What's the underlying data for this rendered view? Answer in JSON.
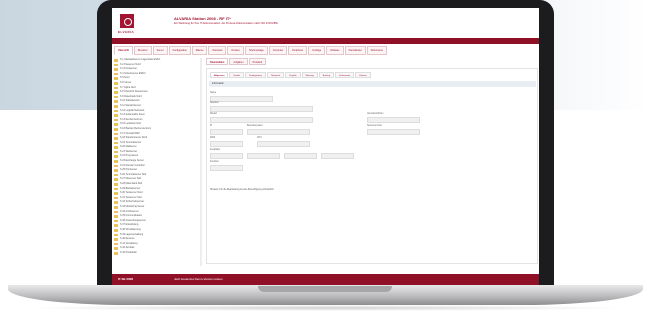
{
  "header": {
    "logo_text": "ELVARIA",
    "title": "ALVARIA Station 2008 - RF IT*",
    "subtitle": "Ein Werkzeug für Ihre IT-Dokumentation, die Prozess-Dokumentation nach ISO 27001/BSI"
  },
  "main_tabs": [
    "Übersicht",
    "Benutzer",
    "Server",
    "Konfiguration",
    "Räume",
    "Netzwerk",
    "Drucker",
    "Telefonanlage",
    "Computer",
    "Peripherie",
    "Verträge",
    "Software",
    "Dienstleister",
    "Dokumente"
  ],
  "tree_items": [
    "S 1 Standardserver Lagerstelle ESKO",
    "S 2 Fileserver Nord",
    "S 3 Firmaserver",
    "S 4 Schutzserver ESKO",
    "S 5 Nord",
    "S 6 Server",
    "S 7 Alpha Netz",
    "S 8 Übersicht Ressourcen",
    "S 9 Datenbank Nord",
    "S 10 Stabsbereich",
    "S 11 Standortserver",
    "S 12 Logistik Netzwerk",
    "S 13 Außenstelle Sued",
    "S 14 Rechenzentrum",
    "S 15 Leitstelle Nord",
    "S 16 Backup Rechenzentrum",
    "S 17 Firewall DMZ",
    "S 18 Standortserver Nord",
    "S 19 Terminalserver",
    "S 20 Mailserver",
    "S 21 Webserver",
    "S 22 Proxyserver",
    "S 23 Exchange Server",
    "S 24 Domain Controller",
    "S 25 Printserver",
    "S 26 Terminalserver Süd",
    "S 27 Fileserver Süd",
    "S 28 Datenbank Süd",
    "S 29 Backupserver",
    "S 30 Testserver Nord",
    "S 31 Testserver Süd",
    "S 32 Sicherheitsserver",
    "S 33 Monitoring Server",
    "S 34 Archivserver",
    "S 35 Kommunikation",
    "S 36 Anwendungsserver",
    "S 37 Entwicklung",
    "S 38 Virtualisierung",
    "S 39 Lagerverwaltung",
    "S 40 Reserve",
    "S 41 Verwaltung",
    "S 42 Zentrale",
    "S 43 Produktion"
  ],
  "subtabs": [
    "Stammdaten",
    "Aufgaben",
    "Protokoll"
  ],
  "inner_tabs": [
    "Allgemein",
    "Details",
    "Konfiguration",
    "Netzwerk",
    "Zugriffe",
    "Wartung",
    "Backup",
    "Dokumente",
    "Historie"
  ],
  "section_title": "Information",
  "fields": {
    "name_label": "Name",
    "location_label": "Standort",
    "model_label": "Modell",
    "ip_label": "IP",
    "os_label": "Betriebssystem",
    "ram_label": "RAM",
    "cpu_label": "CPU",
    "hdd_label": "Festplatte",
    "serial_label": "Seriennummer",
    "owner_label": "Verantwortlicher",
    "purpose_label": "Funktion"
  },
  "note": "Hinweis: Für die Bearbeitung ist eine Berechtigung erforderlich.",
  "footer": {
    "left": "IT-SE 2008",
    "middle": "Jetzt kostenlos Demo-Version testen"
  }
}
